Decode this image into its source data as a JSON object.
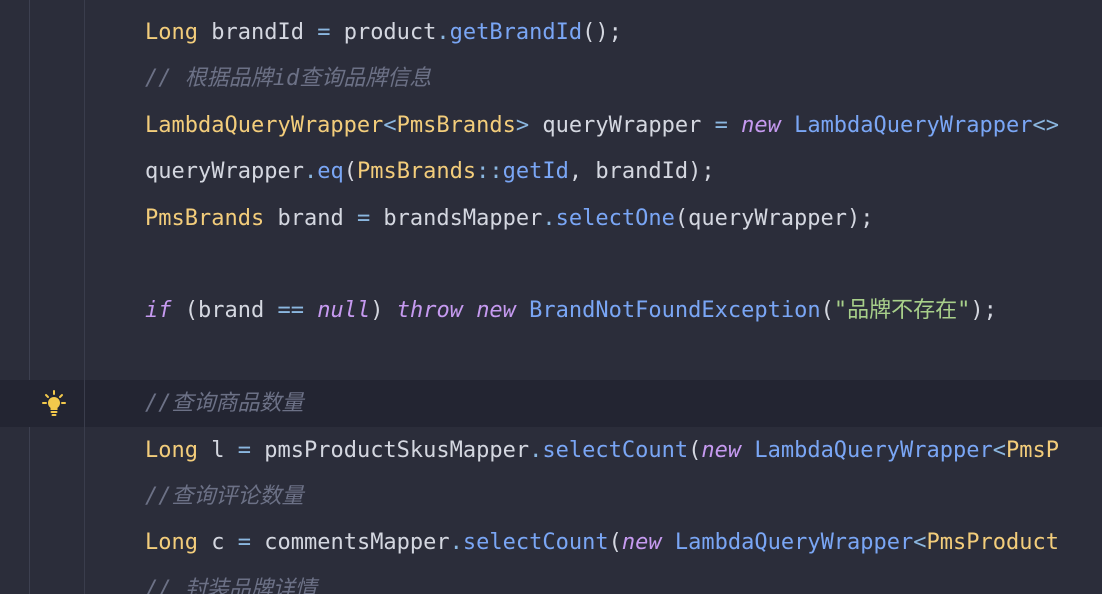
{
  "editor": {
    "lines": [
      {
        "id": "l1",
        "tokens": [
          {
            "t": "Long",
            "c": "kw-type"
          },
          {
            "t": " brandId ",
            "c": "ident"
          },
          {
            "t": "=",
            "c": "op"
          },
          {
            "t": " product",
            "c": "ident"
          },
          {
            "t": ".",
            "c": "op"
          },
          {
            "t": "getBrandId",
            "c": "method"
          },
          {
            "t": "();",
            "c": "punc"
          }
        ]
      },
      {
        "id": "l2",
        "tokens": [
          {
            "t": "// 根据品牌id查询品牌信息",
            "c": "comment"
          }
        ]
      },
      {
        "id": "l3",
        "tokens": [
          {
            "t": "LambdaQueryWrapper",
            "c": "kw-type"
          },
          {
            "t": "<",
            "c": "op"
          },
          {
            "t": "PmsBrands",
            "c": "kw-type"
          },
          {
            "t": ">",
            "c": "op"
          },
          {
            "t": " queryWrapper ",
            "c": "ident"
          },
          {
            "t": "=",
            "c": "op"
          },
          {
            "t": " ",
            "c": "ident"
          },
          {
            "t": "new",
            "c": "keyword"
          },
          {
            "t": " LambdaQueryWrapper",
            "c": "cls"
          },
          {
            "t": "<>",
            "c": "op"
          }
        ]
      },
      {
        "id": "l4",
        "tokens": [
          {
            "t": "queryWrapper",
            "c": "ident"
          },
          {
            "t": ".",
            "c": "op"
          },
          {
            "t": "eq",
            "c": "method"
          },
          {
            "t": "(",
            "c": "punc"
          },
          {
            "t": "PmsBrands",
            "c": "kw-type"
          },
          {
            "t": "::",
            "c": "op"
          },
          {
            "t": "getId",
            "c": "method"
          },
          {
            "t": ", brandId);",
            "c": "ident"
          }
        ]
      },
      {
        "id": "l5",
        "tokens": [
          {
            "t": "PmsBrands",
            "c": "kw-type"
          },
          {
            "t": " brand ",
            "c": "ident"
          },
          {
            "t": "=",
            "c": "op"
          },
          {
            "t": " brandsMapper",
            "c": "ident"
          },
          {
            "t": ".",
            "c": "op"
          },
          {
            "t": "selectOne",
            "c": "method"
          },
          {
            "t": "(queryWrapper);",
            "c": "ident"
          }
        ]
      },
      {
        "id": "l6",
        "tokens": []
      },
      {
        "id": "l7",
        "tokens": [
          {
            "t": "if",
            "c": "keyword"
          },
          {
            "t": " (brand ",
            "c": "ident"
          },
          {
            "t": "==",
            "c": "op"
          },
          {
            "t": " ",
            "c": "ident"
          },
          {
            "t": "null",
            "c": "keyword"
          },
          {
            "t": ") ",
            "c": "ident"
          },
          {
            "t": "throw",
            "c": "keyword"
          },
          {
            "t": " ",
            "c": "ident"
          },
          {
            "t": "new",
            "c": "keyword"
          },
          {
            "t": " BrandNotFoundException",
            "c": "cls"
          },
          {
            "t": "(",
            "c": "punc"
          },
          {
            "t": "\"品牌不存在\"",
            "c": "str"
          },
          {
            "t": ");",
            "c": "punc"
          }
        ]
      },
      {
        "id": "l8",
        "tokens": []
      },
      {
        "id": "l9",
        "tokens": [
          {
            "t": "//查询商品数量",
            "c": "comment"
          }
        ]
      },
      {
        "id": "l10",
        "tokens": [
          {
            "t": "Long",
            "c": "kw-type"
          },
          {
            "t": " l ",
            "c": "ident"
          },
          {
            "t": "=",
            "c": "op"
          },
          {
            "t": " pmsProductSkusMapper",
            "c": "ident"
          },
          {
            "t": ".",
            "c": "op"
          },
          {
            "t": "selectCount",
            "c": "method"
          },
          {
            "t": "(",
            "c": "punc"
          },
          {
            "t": "new",
            "c": "keyword"
          },
          {
            "t": " LambdaQueryWrapper",
            "c": "cls"
          },
          {
            "t": "<",
            "c": "op"
          },
          {
            "t": "PmsP",
            "c": "kw-type"
          }
        ]
      },
      {
        "id": "l11",
        "tokens": [
          {
            "t": "//查询评论数量",
            "c": "comment"
          }
        ]
      },
      {
        "id": "l12",
        "tokens": [
          {
            "t": "Long",
            "c": "kw-type"
          },
          {
            "t": " c ",
            "c": "ident"
          },
          {
            "t": "=",
            "c": "op"
          },
          {
            "t": " commentsMapper",
            "c": "ident"
          },
          {
            "t": ".",
            "c": "op"
          },
          {
            "t": "selectCount",
            "c": "method"
          },
          {
            "t": "(",
            "c": "punc"
          },
          {
            "t": "new",
            "c": "keyword"
          },
          {
            "t": " LambdaQueryWrapper",
            "c": "cls"
          },
          {
            "t": "<",
            "c": "op"
          },
          {
            "t": "PmsProduct",
            "c": "kw-type"
          }
        ]
      },
      {
        "id": "l13",
        "tokens": [
          {
            "t": "// 封装品牌详情",
            "c": "comment"
          }
        ]
      }
    ],
    "gutter_icon": "lightbulb-icon"
  }
}
